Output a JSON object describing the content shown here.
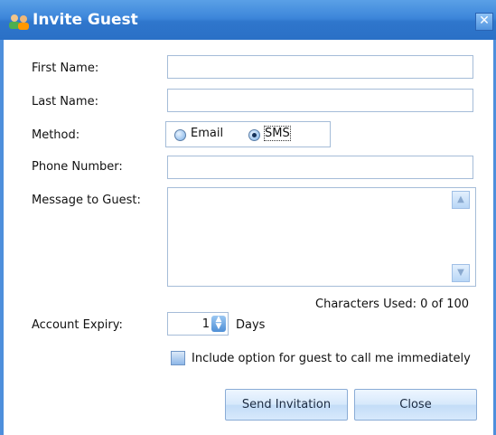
{
  "window": {
    "title": "Invite Guest",
    "close_glyph": "✕",
    "icon": "people-invite-icon"
  },
  "form": {
    "first_name": {
      "label": "First Name:",
      "value": ""
    },
    "last_name": {
      "label": "Last Name:",
      "value": ""
    },
    "method": {
      "label": "Method:",
      "options": [
        {
          "label": "Email",
          "selected": false
        },
        {
          "label": "SMS",
          "selected": true
        }
      ]
    },
    "phone_number": {
      "label": "Phone Number:",
      "value": ""
    },
    "message": {
      "label": "Message to Guest:",
      "value": ""
    },
    "characters_used": "Characters Used: 0 of 100",
    "account_expiry": {
      "label": "Account Expiry:",
      "value": "1",
      "unit": "Days"
    },
    "call_option": {
      "label": "Include option for guest to call me immediately",
      "checked": false
    }
  },
  "buttons": {
    "send": "Send Invitation",
    "close": "Close"
  }
}
